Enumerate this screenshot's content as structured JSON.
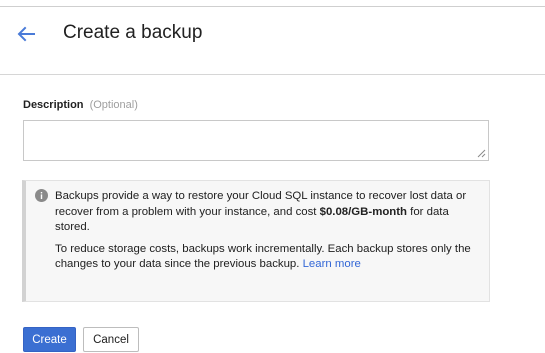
{
  "header": {
    "title": "Create a backup",
    "back_icon": "arrow-left-icon"
  },
  "colors": {
    "accent": "#3b6fd2",
    "link": "#3367d6",
    "info_background": "#f7f7f7"
  },
  "description": {
    "label": "Description",
    "optional_hint": "(Optional)",
    "value": ""
  },
  "info": {
    "icon": "info-icon",
    "p1_before": "Backups provide a way to restore your Cloud SQL instance to recover lost data or recover from a problem with your instance, and cost ",
    "price": "$0.08/GB-month",
    "p1_after": " for data stored.",
    "p2_text": "To reduce storage costs, backups work incrementally. Each backup stores only the changes to your data since the previous backup. ",
    "learn_more": "Learn more"
  },
  "actions": {
    "create_label": "Create",
    "cancel_label": "Cancel"
  }
}
